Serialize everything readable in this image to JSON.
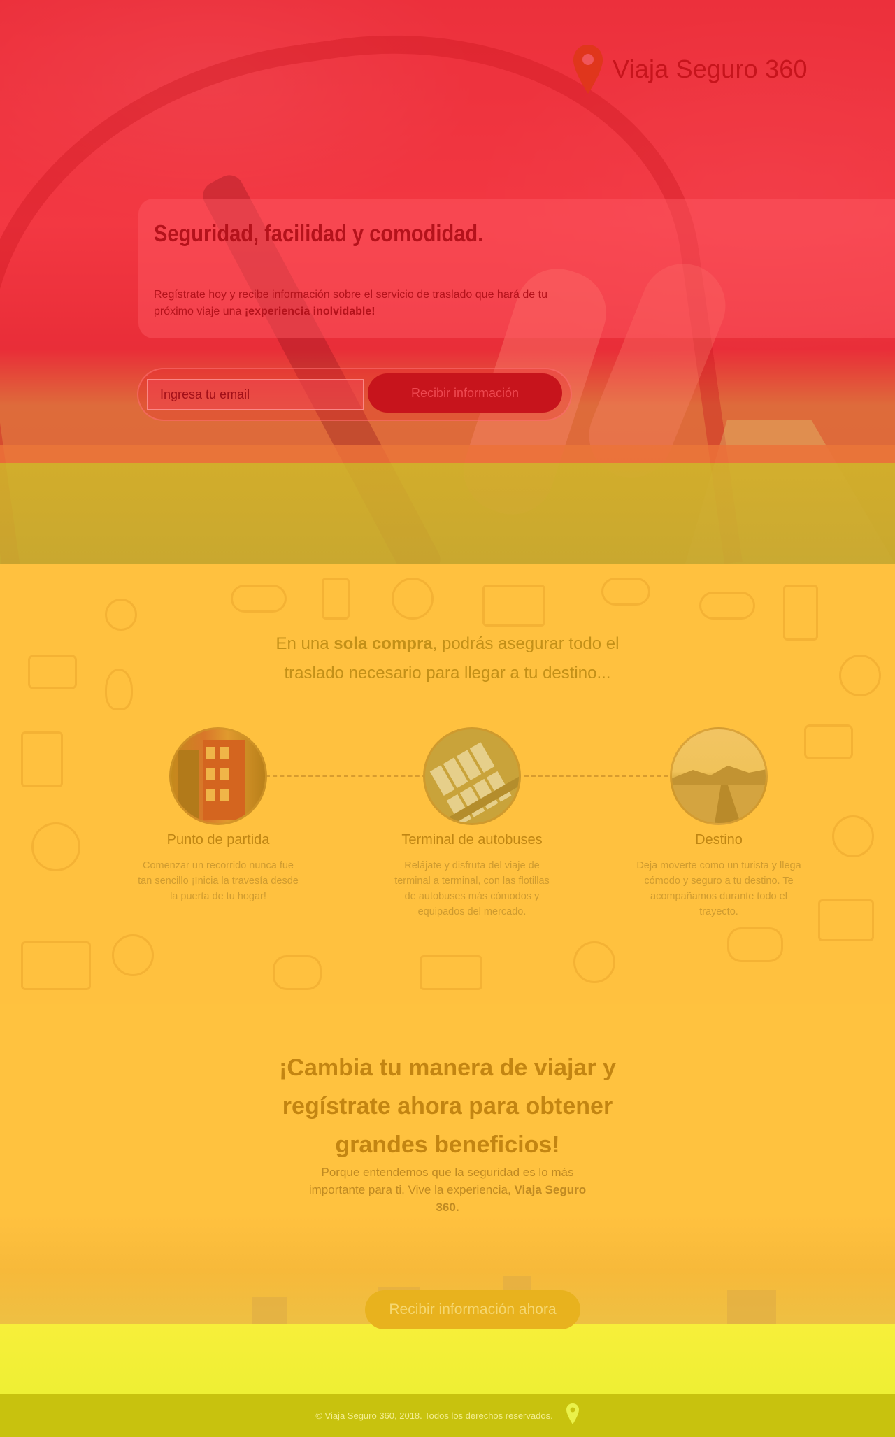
{
  "brand": {
    "name": "Viaja Seguro 360",
    "pin_color": "#e0361c"
  },
  "hero": {
    "title": "Seguridad, facilidad y comodidad.",
    "text_before": "Regístrate hoy y recibe información sobre el servicio de traslado que hará de tu próximo viaje una ",
    "text_bold": "¡experiencia inolvidable!",
    "email_placeholder": "Ingresa tu email",
    "submit_label": "Recibir información"
  },
  "intro": {
    "before": "En una ",
    "bold": "sola compra",
    "after": ", podrás asegurar todo el traslado necesario para llegar a tu destino..."
  },
  "steps": [
    {
      "title": "Punto de partida",
      "description": "Comenzar un recorrido nunca fue tan sencillo ¡Inicia la travesía desde la puerta de tu hogar!",
      "image": "building-photo"
    },
    {
      "title": "Terminal de autobuses",
      "description": "Relájate y disfruta del viaje de terminal a terminal, con las flotillas de autobuses más cómodos y equipados del mercado.",
      "image": "bus-terminal-photo"
    },
    {
      "title": "Destino",
      "description": "Deja moverte como un turista y llega  cómodo y seguro a tu destino. Te acompañamos durante todo el trayecto.",
      "image": "city-destination-photo"
    }
  ],
  "cta": {
    "title": "¡Cambia tu manera de viajar y regístrate ahora para obtener grandes beneficios!",
    "text_before": "Porque entendemos que la seguridad es lo más importante para ti. Vive la experiencia, ",
    "text_bold": "Viaja Seguro 360.",
    "button_label": "Recibir información ahora"
  },
  "footer": {
    "copyright": "© Viaja Seguro 360, 2018. Todos los derechos reservados.",
    "icon": "location-pin-icon",
    "icon_color": "#eaf14a"
  },
  "colors": {
    "hero_overlay": "#f0323c",
    "features_bg": "#ffc13f",
    "accent_red": "#c7141c",
    "footer_bg": "#c8c20e"
  }
}
